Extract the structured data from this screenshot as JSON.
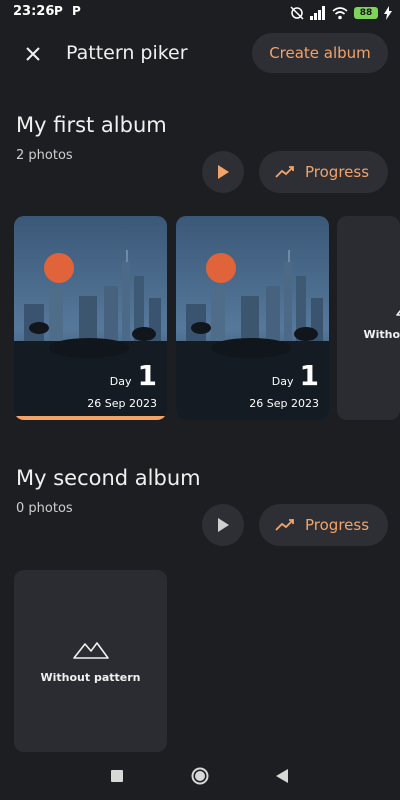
{
  "status_bar": {
    "time": "23:26",
    "notif1": "P",
    "notif2": "P",
    "battery": "88",
    "icons": [
      "alarm-off-icon",
      "signal-icon",
      "wifi-icon",
      "battery-icon",
      "charging-icon"
    ]
  },
  "app_bar": {
    "title": "Pattern piker",
    "create_label": "Create album"
  },
  "albums": [
    {
      "title": "My first album",
      "count": "2 photos",
      "progress_label": "Progress",
      "photos": [
        {
          "day_label": "Day",
          "day_number": "1",
          "date": "26 Sep 2023",
          "selected": true
        },
        {
          "day_label": "Day",
          "day_number": "1",
          "date": "26 Sep 2023",
          "selected": false
        }
      ],
      "pattern_label": "Without pattern"
    },
    {
      "title": "My second album",
      "count": "0 photos",
      "progress_label": "Progress",
      "photos": [],
      "pattern_label": "Without pattern"
    }
  ],
  "colors": {
    "background": "#1d1e22",
    "surface": "#2d2f35",
    "accent": "#f2a36a",
    "play_active": "#f2a36a",
    "play_inactive": "#cfcfcf"
  }
}
